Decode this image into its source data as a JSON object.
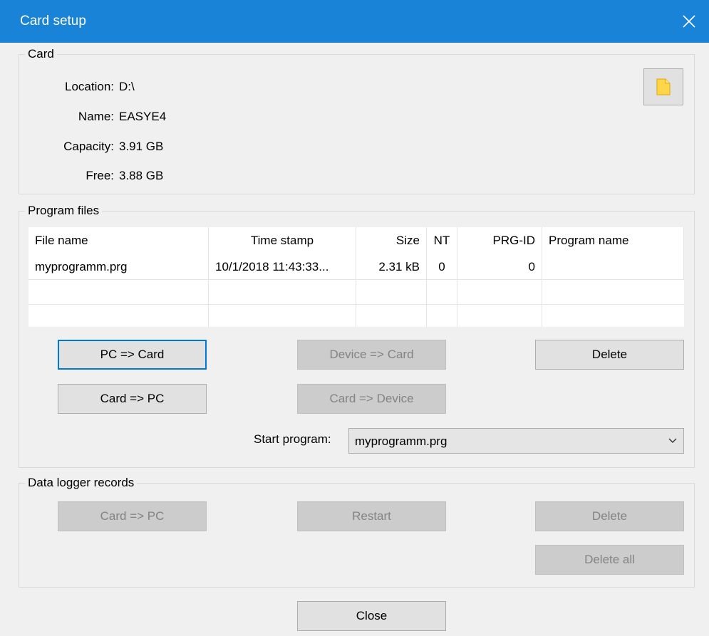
{
  "window": {
    "title": "Card setup"
  },
  "card": {
    "group_label": "Card",
    "location_label": "Location:",
    "location_value": "D:\\",
    "name_label": "Name:",
    "name_value": "EASYE4",
    "capacity_label": "Capacity:",
    "capacity_value": "3.91 GB",
    "free_label": "Free:",
    "free_value": "3.88 GB",
    "browse_icon": "folder-icon"
  },
  "program_files": {
    "group_label": "Program files",
    "columns": [
      "File name",
      "Time stamp",
      "Size",
      "NT",
      "PRG-ID",
      "Program name"
    ],
    "rows": [
      {
        "file_name": "myprogramm.prg",
        "time_stamp": "10/1/2018 11:43:33...",
        "size": "2.31 kB",
        "nt": "0",
        "prg_id": "0",
        "program_name": ""
      }
    ],
    "buttons": {
      "pc_to_card": "PC => Card",
      "device_to_card": "Device => Card",
      "delete": "Delete",
      "card_to_pc": "Card => PC",
      "card_to_device": "Card => Device"
    },
    "start_program_label": "Start program:",
    "start_program_value": "myprogramm.prg"
  },
  "data_logger": {
    "group_label": "Data logger records",
    "buttons": {
      "card_to_pc": "Card => PC",
      "restart": "Restart",
      "delete": "Delete",
      "delete_all": "Delete all"
    }
  },
  "footer": {
    "close": "Close"
  },
  "colors": {
    "titlebar": "#1883d7",
    "accent": "#0078d7",
    "folder": "#ffd54a"
  }
}
